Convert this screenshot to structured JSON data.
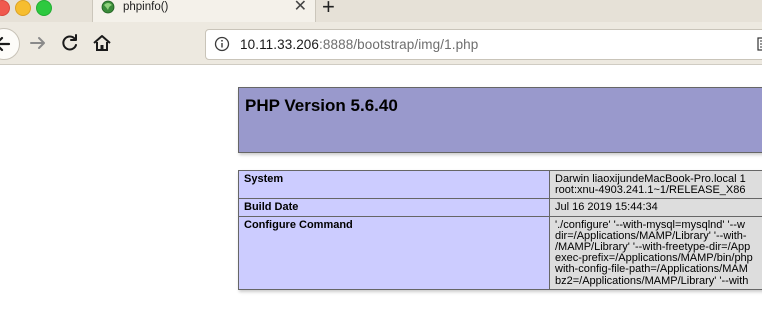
{
  "browser": {
    "tab": {
      "title": "phpinfo()",
      "close_glyph": "✕"
    },
    "new_tab_glyph": "+",
    "address": {
      "host": "10.11.33.206",
      "rest": ":8888/bootstrap/img/1.php"
    },
    "icons": [
      "back-arrow-icon",
      "forward-arrow-icon",
      "reload-icon",
      "home-icon",
      "info-icon",
      "reader-view-icon"
    ]
  },
  "page": {
    "title": "PHP Version 5.6.40",
    "colors": {
      "header_bg": "#9999cc",
      "key_bg": "#ccccff",
      "value_bg": "#dddddd"
    },
    "rows": [
      {
        "key": "System",
        "lines": [
          "Darwin liaoxijundeMacBook-Pro.local 1",
          "root:xnu-4903.241.1~1/RELEASE_X86"
        ]
      },
      {
        "key": "Build Date",
        "lines": [
          "Jul 16 2019 15:44:34"
        ]
      },
      {
        "key": "Configure Command",
        "lines": [
          "'./configure' '--with-mysql=mysqlnd' '--w",
          "dir=/Applications/MAMP/Library' '--with-",
          "/MAMP/Library' '--with-freetype-dir=/App",
          "exec-prefix=/Applications/MAMP/bin/php",
          "with-config-file-path=/Applications/MAM",
          "bz2=/Applications/MAMP/Library' '--with"
        ]
      }
    ]
  }
}
